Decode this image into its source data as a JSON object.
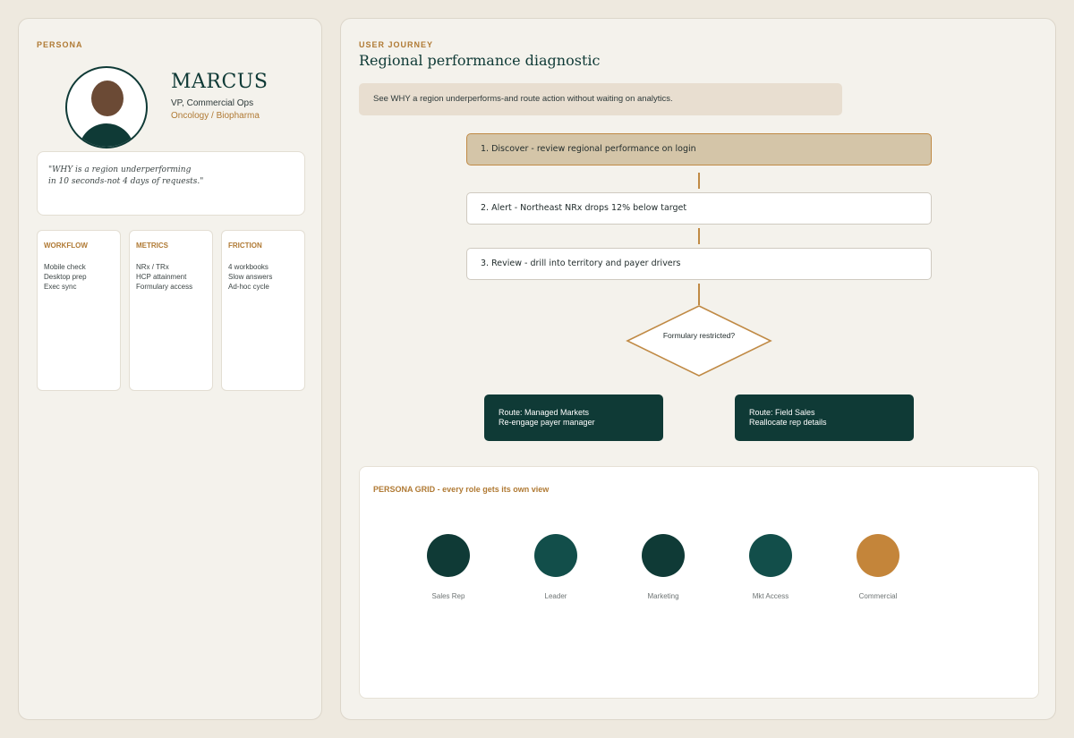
{
  "colors": {
    "primary": "#0F3A36",
    "secondary": "#124E4A",
    "accent": "#C4853A",
    "step_active": "#D4C5A8",
    "banner": "#E8DED0"
  },
  "persona": {
    "section_label": "PERSONA",
    "name": "MARCUS",
    "role": "VP, Commercial Ops",
    "sector": "Oncology / Biopharma",
    "quote": [
      "\"WHY is a region underperforming",
      "in 10 seconds-not 4 days of requests.\""
    ],
    "cards": [
      {
        "title": "WORKFLOW",
        "items": [
          "Mobile check",
          "Desktop prep",
          "Exec sync"
        ]
      },
      {
        "title": "METRICS",
        "items": [
          "NRx / TRx",
          "HCP attainment",
          "Formulary access"
        ]
      },
      {
        "title": "FRICTION",
        "items": [
          "4 workbooks",
          "Slow answers",
          "Ad-hoc cycle"
        ]
      }
    ]
  },
  "journey": {
    "section_label": "USER JOURNEY",
    "title": "Regional performance diagnostic",
    "banner": "See WHY a region underperforms-and route action without waiting on analytics.",
    "steps": [
      "1. Discover - review regional performance on login",
      "2. Alert - Northeast NRx drops 12% below target",
      "3. Review - drill into territory and payer drivers"
    ],
    "decision": "Formulary restricted?",
    "routes": [
      {
        "title": "Route: Managed Markets",
        "detail": "Re-engage payer manager"
      },
      {
        "title": "Route: Field Sales",
        "detail": "Reallocate rep details"
      }
    ]
  },
  "persona_grid": {
    "title": "PERSONA GRID - every role gets its own view",
    "roles": [
      {
        "label": "Sales Rep",
        "color": "#0F3A36"
      },
      {
        "label": "Leader",
        "color": "#124E4A"
      },
      {
        "label": "Marketing",
        "color": "#0F3A36"
      },
      {
        "label": "Mkt Access",
        "color": "#124E4A"
      },
      {
        "label": "Commercial",
        "color": "#C4853A"
      }
    ]
  }
}
